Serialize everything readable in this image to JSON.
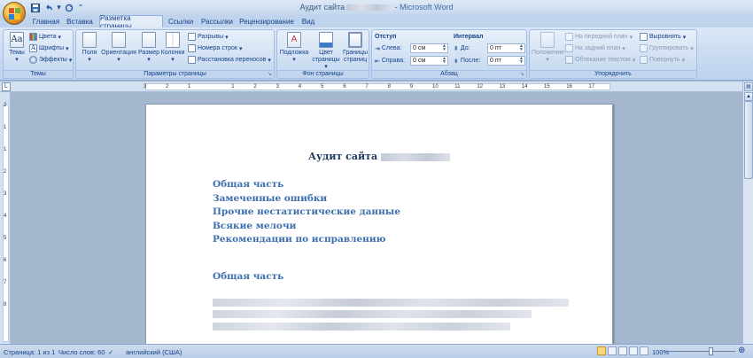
{
  "window": {
    "title_doc": "Аудит сайта",
    "title_sep": " - ",
    "title_app": "Microsoft Word"
  },
  "tabs": [
    {
      "label": "Главная"
    },
    {
      "label": "Вставка"
    },
    {
      "label": "Разметка страницы",
      "active": true
    },
    {
      "label": "Ссылки"
    },
    {
      "label": "Рассылки"
    },
    {
      "label": "Рецензирование"
    },
    {
      "label": "Вид"
    }
  ],
  "ribbon": {
    "themes": {
      "label": "Темы",
      "themes_btn": "Темы",
      "colors": "Цвета",
      "fonts": "Шрифты",
      "effects": "Эффекты"
    },
    "page_setup": {
      "label": "Параметры страницы",
      "margins": "Поля",
      "orientation": "Ориентация",
      "size": "Размер",
      "columns": "Колонки",
      "breaks": "Разрывы",
      "line_numbers": "Номера строк",
      "hyphenation": "Расстановка переносов"
    },
    "page_background": {
      "label": "Фон страницы",
      "watermark": "Подложка",
      "page_color_1": "Цвет",
      "page_color_2": "страницы",
      "page_borders_1": "Границы",
      "page_borders_2": "страниц"
    },
    "paragraph": {
      "label": "Абзац",
      "indent_title": "Отступ",
      "left_label": "Слева:",
      "left_value": "0 см",
      "right_label": "Справа:",
      "right_value": "0 см",
      "spacing_title": "Интервал",
      "before_label": "До:",
      "before_value": "0 пт",
      "after_label": "После:",
      "after_value": "0 пт"
    },
    "arrange": {
      "label": "Упорядочить",
      "position": "Положение",
      "bring_front": "На передний план",
      "send_back": "На задний план",
      "text_wrap": "Обтекание текстом",
      "align": "Выровнять",
      "group": "Группировать",
      "rotate": "Повернуть"
    }
  },
  "ruler": {
    "numbers": [
      "3",
      "2",
      "1",
      "1",
      "2",
      "3",
      "4",
      "5",
      "6",
      "7",
      "8",
      "9",
      "10",
      "11",
      "12",
      "13",
      "14",
      "15",
      "16",
      "17"
    ],
    "vnumbers": [
      "2",
      "1",
      "1",
      "2",
      "3",
      "4",
      "5",
      "6",
      "7",
      "8"
    ]
  },
  "document": {
    "title": "Аудит сайта",
    "toc": [
      "Общая часть",
      "Замеченные ошибки",
      "Прочие нестатистические данные",
      "Всякие мелочи",
      "Рекомендации по исправлению"
    ],
    "section_heading": "Общая часть"
  },
  "statusbar": {
    "page": "Страница: 1 из 1",
    "words": "Число слов: 60",
    "language": "английский (США)",
    "zoom": "100%"
  },
  "colors": {
    "heading_blue": "#3d6fae",
    "title_dark": "#1f3a64",
    "ribbon_text": "#15428b"
  }
}
